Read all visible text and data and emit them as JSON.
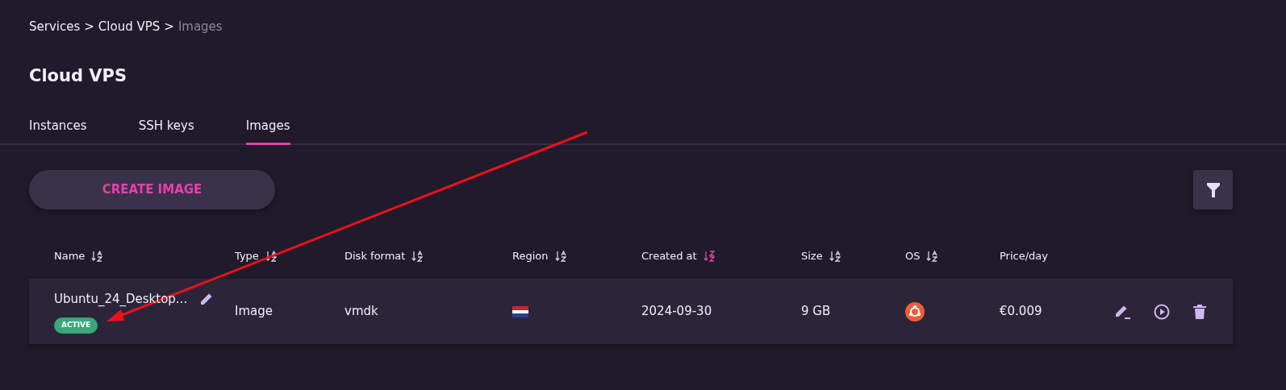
{
  "breadcrumb": [
    {
      "label": "Services",
      "current": false
    },
    {
      "label": "Cloud VPS",
      "current": false
    },
    {
      "label": "Images",
      "current": true
    }
  ],
  "breadcrumb_separator": ">",
  "title": "Cloud VPS",
  "tabs": [
    {
      "label": "Instances",
      "selected": false
    },
    {
      "label": "SSH keys",
      "selected": false
    },
    {
      "label": "Images",
      "selected": true
    }
  ],
  "create_button": "CREATE IMAGE",
  "columns": [
    {
      "label": "Name",
      "sort_active": false
    },
    {
      "label": "Type",
      "sort_active": false
    },
    {
      "label": "Disk format",
      "sort_active": false
    },
    {
      "label": "Region",
      "sort_active": false
    },
    {
      "label": "Created at",
      "sort_active": true
    },
    {
      "label": "Size",
      "sort_active": false
    },
    {
      "label": "OS",
      "sort_active": false
    },
    {
      "label": "Price/day"
    }
  ],
  "rows": [
    {
      "name": "Ubuntu_24_Desktop...",
      "status": "ACTIVE",
      "type": "Image",
      "disk_format": "vmdk",
      "created_at": "2024-09-30",
      "size": "9 GB",
      "price": "€0.009"
    }
  ]
}
